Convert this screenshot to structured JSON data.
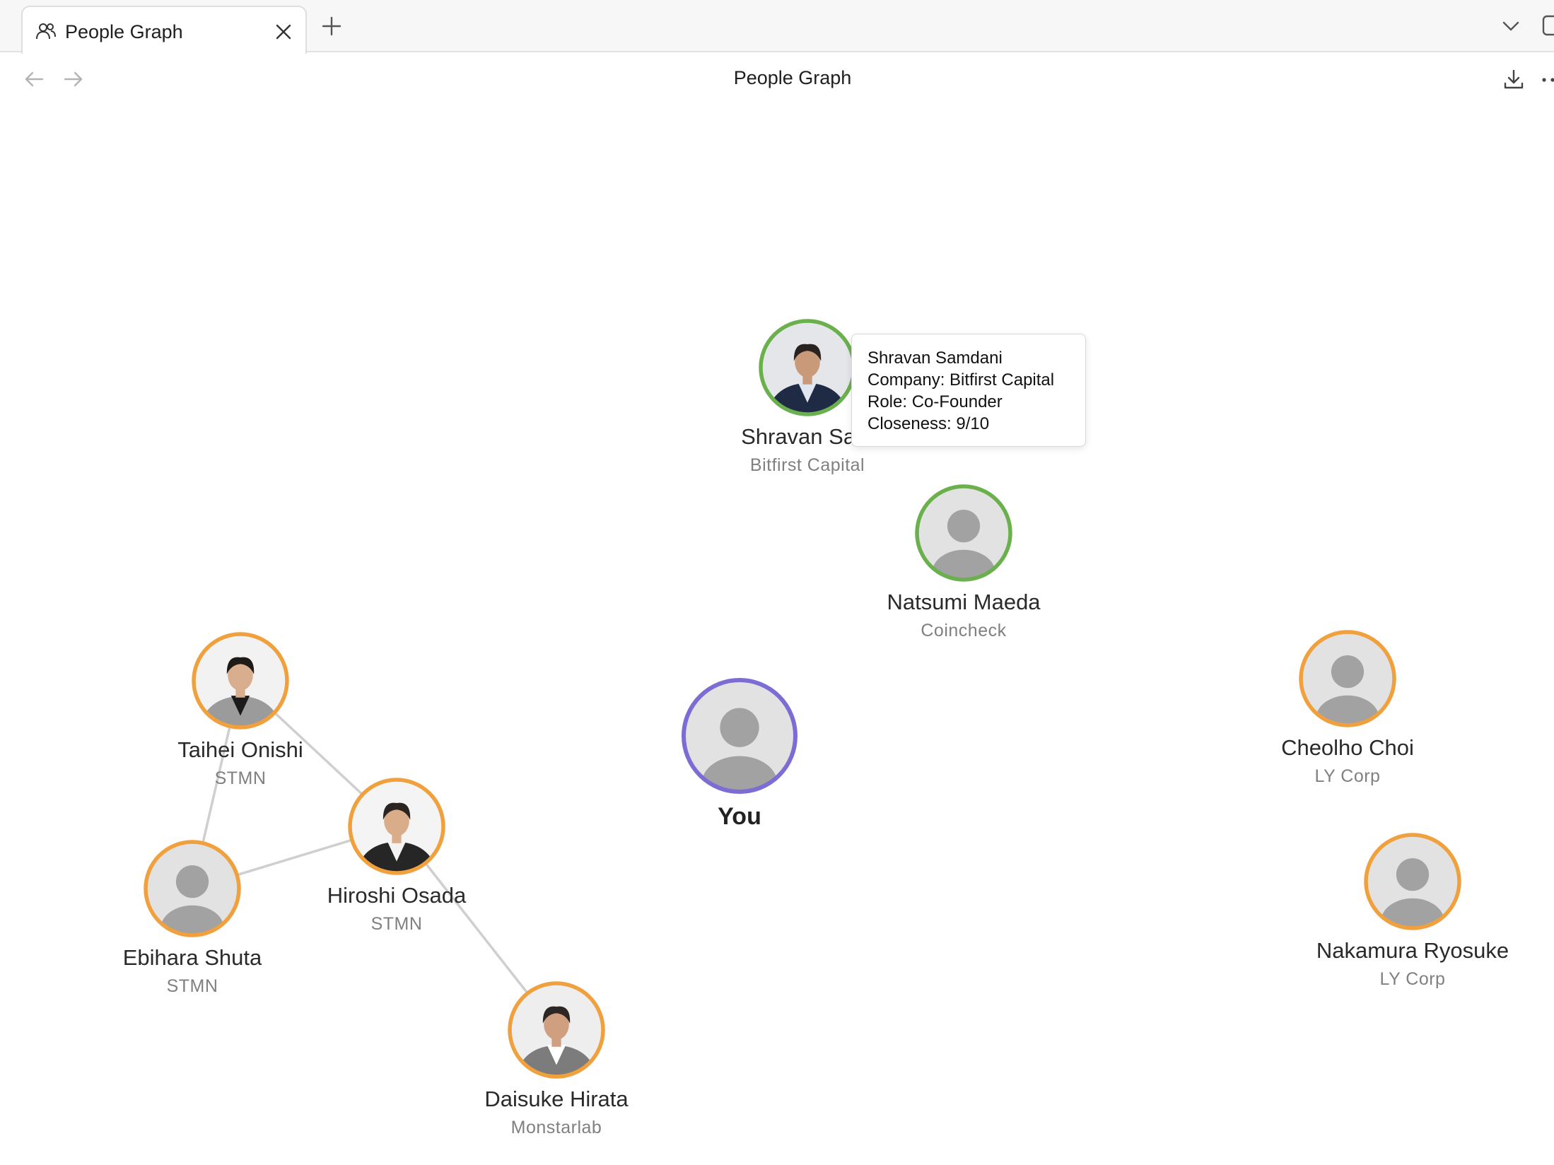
{
  "tab": {
    "title": "People Graph",
    "icon": "people-icon"
  },
  "toolbar": {
    "title": "People Graph"
  },
  "colors": {
    "you": "#7b6dd4",
    "close": "#6ab04c",
    "medium": "#f0a03c",
    "edge": "#cfcfcf",
    "avatar_bg": "#e2e2e2",
    "avatar_fg": "#a2a2a2"
  },
  "you": {
    "label": "You"
  },
  "people": [
    {
      "name": "Shravan Samdani",
      "display_name": "Shravan Sam",
      "company": "Bitfirst Capital",
      "group": "close",
      "photo": true
    },
    {
      "name": "Natsumi Maeda",
      "display_name": "Natsumi Maeda",
      "company": "Coincheck",
      "group": "close",
      "photo": false
    },
    {
      "name": "Cheolho Choi",
      "display_name": "Cheolho Choi",
      "company": "LY Corp",
      "group": "medium",
      "photo": false
    },
    {
      "name": "Nakamura Ryosuke",
      "display_name": "Nakamura Ryosuke",
      "company": "LY Corp",
      "group": "medium",
      "photo": false
    },
    {
      "name": "Taihei Onishi",
      "display_name": "Taihei Onishi",
      "company": "STMN",
      "group": "medium",
      "photo": true
    },
    {
      "name": "Hiroshi Osada",
      "display_name": "Hiroshi Osada",
      "company": "STMN",
      "group": "medium",
      "photo": true
    },
    {
      "name": "Ebihara Shuta",
      "display_name": "Ebihara Shuta",
      "company": "STMN",
      "group": "medium",
      "photo": false
    },
    {
      "name": "Daisuke Hirata",
      "display_name": "Daisuke Hirata",
      "company": "Monstarlab",
      "group": "medium",
      "photo": true
    }
  ],
  "edges": [
    [
      "Taihei Onishi",
      "Hiroshi Osada"
    ],
    [
      "Taihei Onishi",
      "Ebihara Shuta"
    ],
    [
      "Ebihara Shuta",
      "Hiroshi Osada"
    ],
    [
      "Hiroshi Osada",
      "Daisuke Hirata"
    ]
  ],
  "tooltip": {
    "name": "Shravan Samdani",
    "company_line": "Company: Bitfirst Capital",
    "role_line": "Role: Co-Founder",
    "closeness_line": "Closeness: 9/10"
  }
}
